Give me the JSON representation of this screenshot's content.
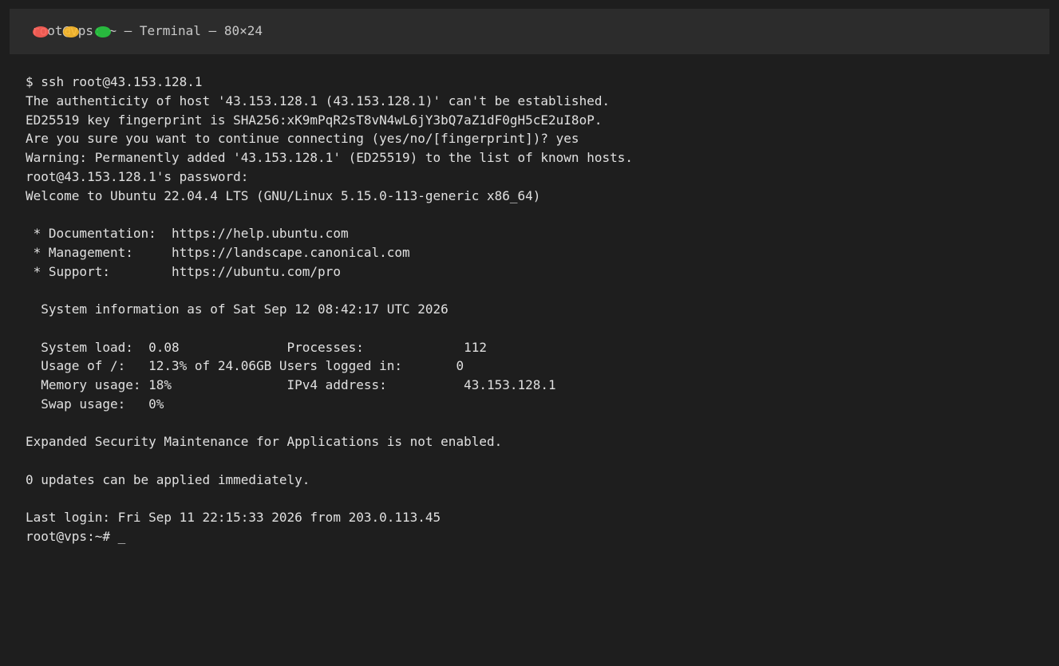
{
  "window": {
    "title": "root@vps: ~ — Terminal — 80×24",
    "traffic_lights": {
      "close": "#ff5f57",
      "minimize": "#febc2e",
      "zoom": "#28c840"
    }
  },
  "terminal": {
    "lines": [
      "$ ssh root@43.153.128.1",
      "The authenticity of host '43.153.128.1 (43.153.128.1)' can't be established.",
      "ED25519 key fingerprint is SHA256:xK9mPqR2sT8vN4wL6jY3bQ7aZ1dF0gH5cE2uI8oP.",
      "Are you sure you want to continue connecting (yes/no/[fingerprint])? yes",
      "Warning: Permanently added '43.153.128.1' (ED25519) to the list of known hosts.",
      "root@43.153.128.1's password:",
      "Welcome to Ubuntu 22.04.4 LTS (GNU/Linux 5.15.0-113-generic x86_64)",
      "",
      " * Documentation:  https://help.ubuntu.com",
      " * Management:     https://landscape.canonical.com",
      " * Support:        https://ubuntu.com/pro",
      "",
      "  System information as of Sat Sep 12 08:42:17 UTC 2026",
      "",
      "  System load:  0.08              Processes:             112",
      "  Usage of /:   12.3% of 24.06GB Users logged in:       0",
      "  Memory usage: 18%               IPv4 address:          43.153.128.1",
      "  Swap usage:   0%",
      "",
      "Expanded Security Maintenance for Applications is not enabled.",
      "",
      "0 updates can be applied immediately.",
      "",
      "Last login: Fri Sep 11 22:15:33 2026 from 203.0.113.45"
    ],
    "prompt": "root@vps:~# ",
    "cursor": "_"
  }
}
